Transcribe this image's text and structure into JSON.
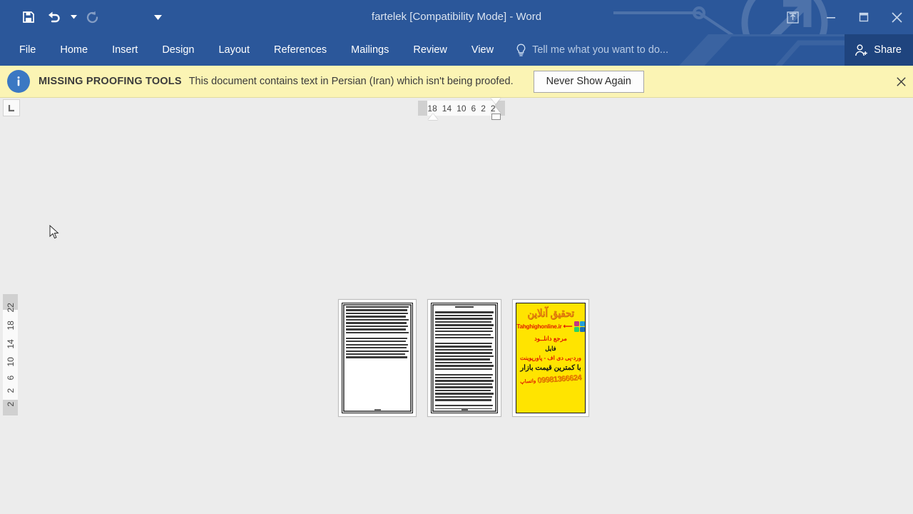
{
  "window": {
    "title": "fartelek [Compatibility Mode] - Word",
    "accent_color": "#2b579a",
    "share_bg_color": "#1f447e"
  },
  "quick_access": {
    "items": [
      {
        "name": "save",
        "label": "Save",
        "icon": "save-icon",
        "enabled": true
      },
      {
        "name": "undo",
        "label": "Undo",
        "icon": "undo-icon",
        "enabled": true
      },
      {
        "name": "undo-dropdown",
        "label": "Undo options",
        "icon": "chevron-down-icon",
        "enabled": true
      },
      {
        "name": "redo",
        "label": "Repeat",
        "icon": "redo-icon",
        "enabled": false
      },
      {
        "name": "customize",
        "label": "Customize Quick Access Toolbar",
        "icon": "chevron-down-icon",
        "enabled": true
      }
    ]
  },
  "window_controls": [
    {
      "name": "ribbon-display-options",
      "label": "Ribbon Display Options",
      "icon": "ribbon-display-icon"
    },
    {
      "name": "minimize",
      "label": "Minimize",
      "icon": "minimize-icon"
    },
    {
      "name": "maximize",
      "label": "Restore Down",
      "icon": "maximize-icon"
    },
    {
      "name": "close",
      "label": "Close",
      "icon": "close-icon"
    }
  ],
  "ribbon": {
    "tabs": [
      {
        "id": "file",
        "label": "File"
      },
      {
        "id": "home",
        "label": "Home"
      },
      {
        "id": "insert",
        "label": "Insert"
      },
      {
        "id": "design",
        "label": "Design"
      },
      {
        "id": "layout",
        "label": "Layout"
      },
      {
        "id": "references",
        "label": "References"
      },
      {
        "id": "mailings",
        "label": "Mailings"
      },
      {
        "id": "review",
        "label": "Review"
      },
      {
        "id": "view",
        "label": "View"
      }
    ],
    "tell_me": {
      "placeholder": "Tell me what you want to do...",
      "icon": "lightbulb-icon"
    },
    "share": {
      "label": "Share",
      "icon": "share-person-icon"
    }
  },
  "info_bar": {
    "icon": "info-icon",
    "title": "MISSING PROOFING TOOLS",
    "message": "This document contains text in Persian (Iran) which isn't being proofed.",
    "button_label": "Never Show Again",
    "close_label": "×",
    "background_color": "#fbf4b4"
  },
  "rulers": {
    "tab_stop_selector": "L",
    "horizontal_ticks": [
      "18",
      "14",
      "10",
      "6",
      "2",
      "2"
    ],
    "vertical_ticks": [
      "2",
      "2",
      "6",
      "10",
      "14",
      "18",
      "22"
    ]
  },
  "document": {
    "pages": [
      {
        "number": 1,
        "type": "text",
        "border": "double-frame",
        "lines": 16
      },
      {
        "number": 2,
        "type": "text",
        "border": "double-frame",
        "lines": 38
      },
      {
        "number": 3,
        "type": "advertisement",
        "border": "double-frame"
      }
    ],
    "ad": {
      "title": "تحقیق آنلاین",
      "site": "Tahghighonline.ir",
      "line1": "مرجع دانلــود",
      "line2": "فایل",
      "line3": "ورد-پی دی اف - پاورپوینت",
      "line4": "با کمترین قیمت بازار",
      "whatsapp_label": "واتساپ",
      "phone": "09981366624",
      "bg_color": "#ffe400",
      "title_color": "#e8820c",
      "accent_color": "#e01b00"
    }
  }
}
